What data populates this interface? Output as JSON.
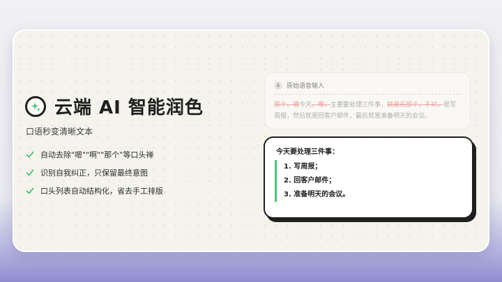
{
  "brand": {
    "title": "云端 AI 智能润色",
    "subtitle": "口语秒变清晰文本",
    "accent": "#4fc27b"
  },
  "features": [
    "自动去除\"嗯\"\"啊\"\"那个\"等口头禅",
    "识别自我纠正，只保留最终意图",
    "口头列表自动结构化，省去手工排版"
  ],
  "input_card": {
    "header": "原始语音输入",
    "transcript": [
      {
        "text": "那个，嗯",
        "filler": true
      },
      {
        "text": "今天",
        "filler": false
      },
      {
        "text": "，嗯，",
        "filler": true
      },
      {
        "text": "主要要处理三件事，",
        "filler": false
      },
      {
        "text": "就是先那个，不对，",
        "filler": true
      },
      {
        "text": "是写周报，然后就是回客户邮件，最后就是准备明天的会议。",
        "filler": false
      }
    ]
  },
  "output_card": {
    "heading": "今天要处理三件事：",
    "items": [
      "1. 写周报；",
      "2. 回客户邮件；",
      "3. 准备明天的会议。"
    ]
  }
}
